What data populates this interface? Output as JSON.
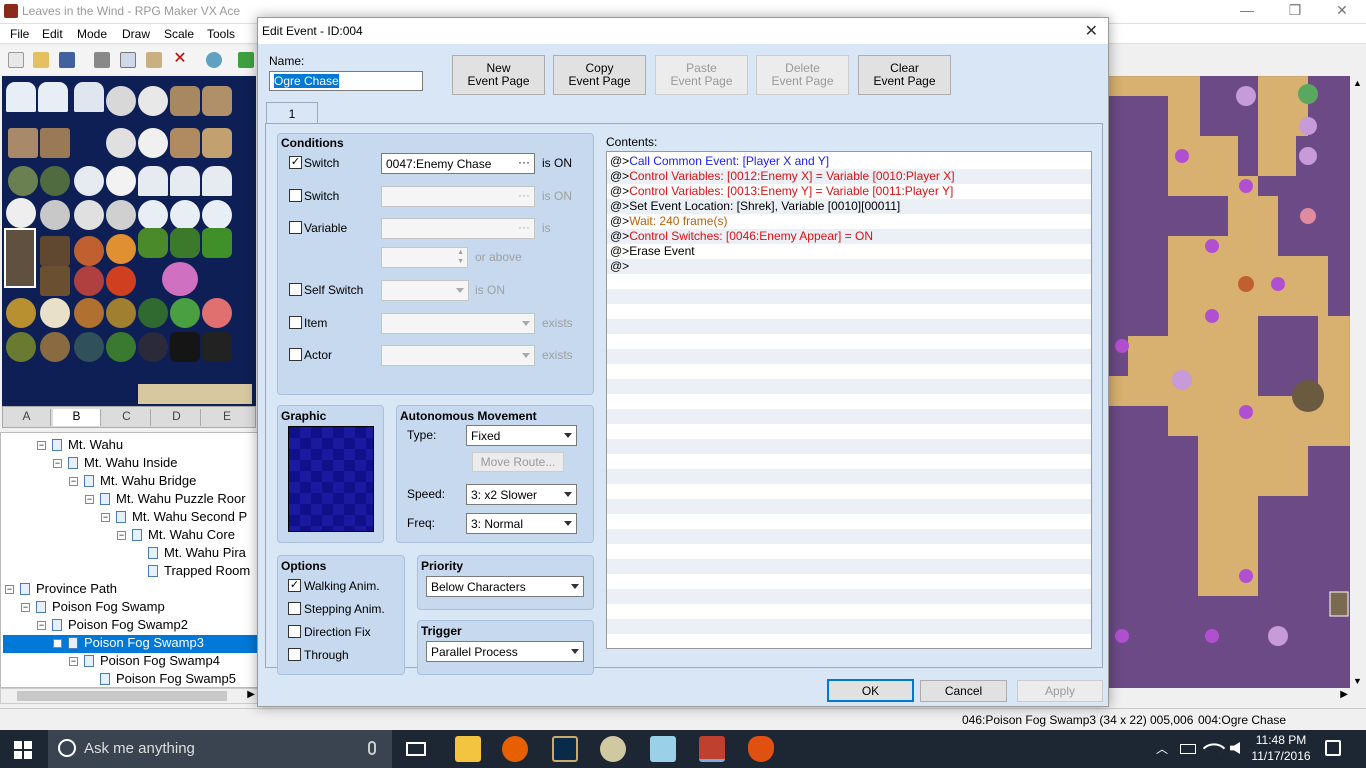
{
  "app": {
    "title": "Leaves in the Wind - RPG Maker VX Ace",
    "menu": [
      "File",
      "Edit",
      "Mode",
      "Draw",
      "Scale",
      "Tools"
    ],
    "tileset_tabs": [
      "A",
      "B",
      "C",
      "D",
      "E"
    ],
    "active_tab": "B"
  },
  "tree": {
    "items": [
      {
        "label": "Mt. Wahu",
        "level": 0,
        "selected": false
      },
      {
        "label": "Mt. Wahu Inside",
        "level": 1,
        "selected": false
      },
      {
        "label": "Mt. Wahu Bridge",
        "level": 2,
        "selected": false
      },
      {
        "label": "Mt. Wahu Puzzle Roor",
        "level": 3,
        "selected": false
      },
      {
        "label": "Mt. Wahu Second P",
        "level": 4,
        "selected": false
      },
      {
        "label": "Mt. Wahu Core",
        "level": 5,
        "selected": false
      },
      {
        "label": "Mt. Wahu Pira",
        "level": 6,
        "selected": false
      },
      {
        "label": "Trapped Room",
        "level": 6,
        "selected": false
      },
      {
        "label": "Province Path",
        "level": -2,
        "selected": false
      },
      {
        "label": "Poison Fog Swamp",
        "level": -1,
        "selected": false
      },
      {
        "label": "Poison Fog Swamp2",
        "level": 0,
        "selected": false
      },
      {
        "label": "Poison Fog Swamp3",
        "level": 1,
        "selected": true
      },
      {
        "label": "Poison Fog Swamp4",
        "level": 2,
        "selected": false
      },
      {
        "label": "Poison Fog Swamp5",
        "level": 3,
        "selected": false
      }
    ]
  },
  "statusbar": {
    "map": "046:Poison Fog Swamp3 (34 x 22)",
    "coords": "005,006",
    "event": "004:Ogre Chase"
  },
  "dialog": {
    "title": "Edit Event - ID:004",
    "name_label": "Name:",
    "name_value": "Ogre Chase",
    "buttons": {
      "new_page": [
        "New",
        "Event Page"
      ],
      "copy_page": [
        "Copy",
        "Event Page"
      ],
      "paste_page": [
        "Paste",
        "Event Page"
      ],
      "delete_page": [
        "Delete",
        "Event Page"
      ],
      "clear_page": [
        "Clear",
        "Event Page"
      ]
    },
    "page_tab": "1",
    "conditions": {
      "title": "Conditions",
      "switch1_label": "Switch",
      "switch1_value": "0047:Enemy Chase",
      "switch1_suffix": "is ON",
      "switch2_label": "Switch",
      "switch2_suffix": "is ON",
      "variable_label": "Variable",
      "variable_suffix": "is",
      "or_above": "or above",
      "self_switch_label": "Self Switch",
      "self_switch_suffix": "is ON",
      "item_label": "Item",
      "item_suffix": "exists",
      "actor_label": "Actor",
      "actor_suffix": "exists"
    },
    "graphic_label": "Graphic",
    "movement": {
      "title": "Autonomous Movement",
      "type_label": "Type:",
      "type_value": "Fixed",
      "move_route": "Move Route...",
      "speed_label": "Speed:",
      "speed_value": "3: x2 Slower",
      "freq_label": "Freq:",
      "freq_value": "3: Normal"
    },
    "options": {
      "title": "Options",
      "walking": "Walking Anim.",
      "stepping": "Stepping Anim.",
      "direction_fix": "Direction Fix",
      "through": "Through"
    },
    "priority": {
      "title": "Priority",
      "value": "Below Characters"
    },
    "trigger": {
      "title": "Trigger",
      "value": "Parallel Process"
    },
    "contents_label": "Contents:",
    "contents": [
      {
        "prefix": "@>",
        "text": "Call Common Event: [Player X and Y]",
        "color": "#1a1aff"
      },
      {
        "prefix": "@>",
        "text": "Control Variables: [0012:Enemy X] = Variable [0010:Player X]",
        "color": "#e01010"
      },
      {
        "prefix": "@>",
        "text": "Control Variables: [0013:Enemy Y] = Variable [0011:Player Y]",
        "color": "#e01010"
      },
      {
        "prefix": "@>",
        "text": "Set Event Location: [Shrek], Variable [0010][00011]",
        "color": "#000000"
      },
      {
        "prefix": "@>",
        "text": "Wait: 240 frame(s)",
        "color": "#c06000"
      },
      {
        "prefix": "@>",
        "text": "Control Switches: [0046:Enemy Appear] = ON",
        "color": "#e01010"
      },
      {
        "prefix": "@>",
        "text": "Erase Event",
        "color": "#000000"
      },
      {
        "prefix": "@>",
        "text": "",
        "color": "#000000"
      }
    ],
    "ok": "OK",
    "cancel": "Cancel",
    "apply": "Apply"
  },
  "taskbar": {
    "search_placeholder": "Ask me anything",
    "time": "11:48 PM",
    "date": "11/17/2016"
  }
}
